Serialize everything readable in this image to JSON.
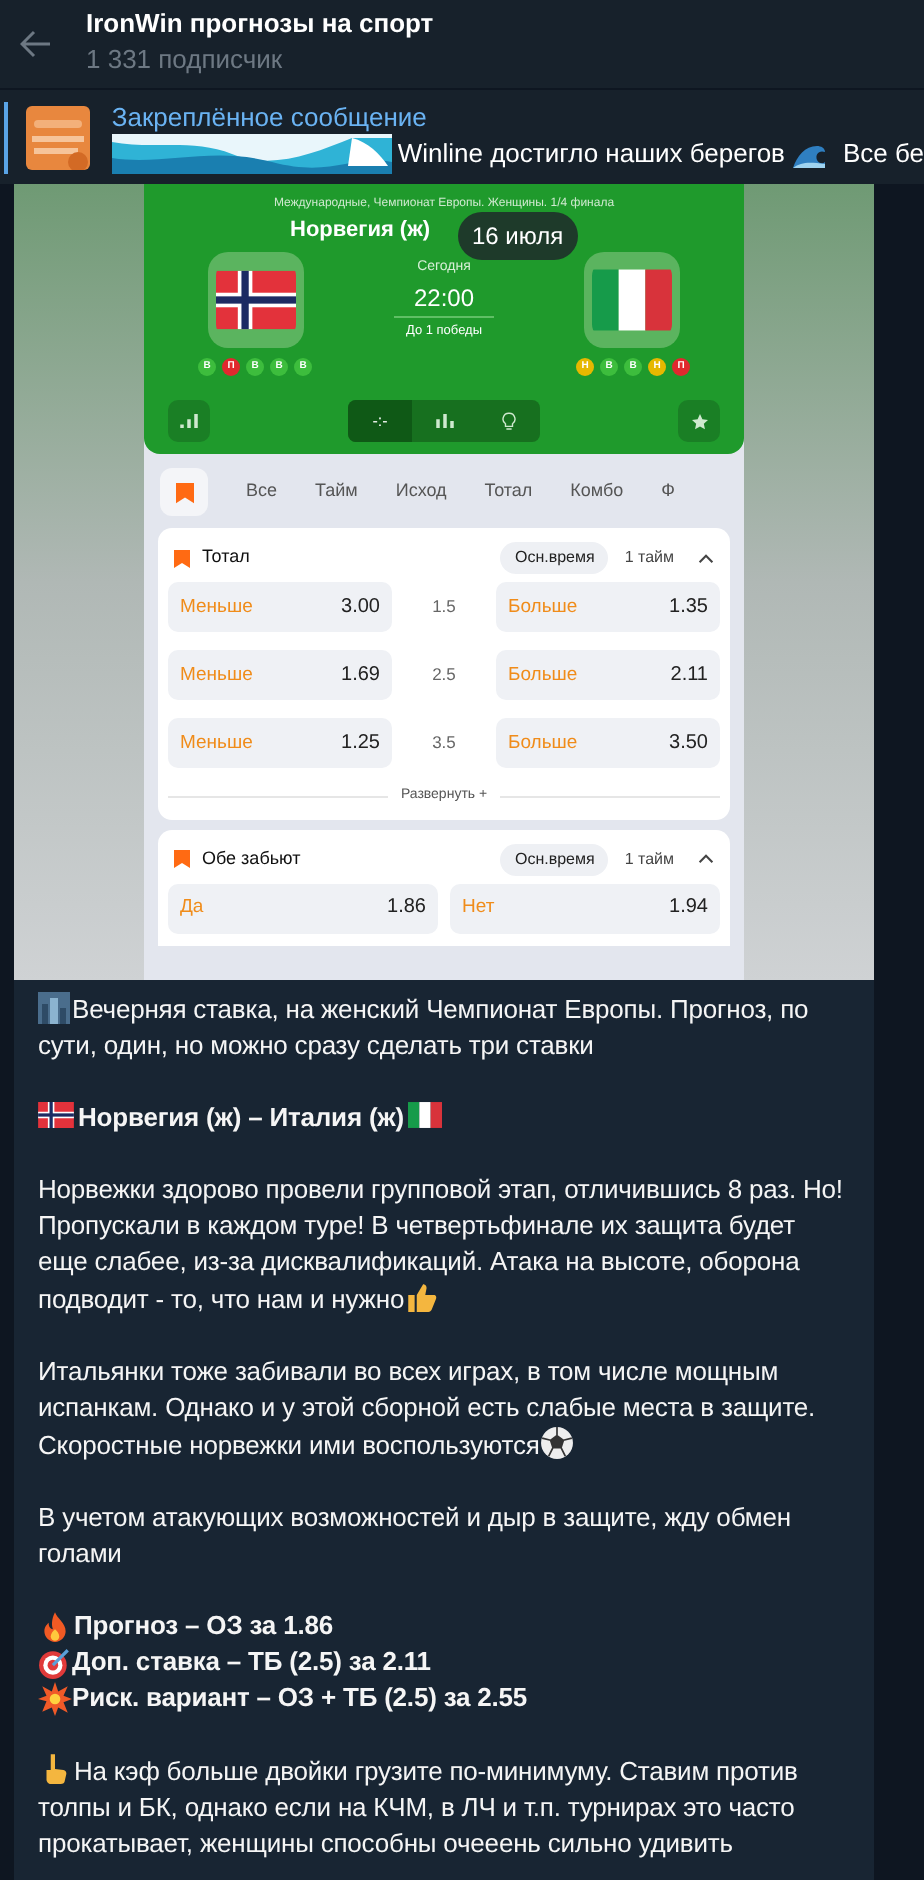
{
  "header": {
    "title": "IronWin прогнозы на спорт",
    "subtitle": "1 331 подписчик"
  },
  "pinned": {
    "title": "Закреплённое сообщение",
    "text": "Winline достигло наших берегов",
    "text_tail": "Все бе"
  },
  "date_pill": "16 июля",
  "app": {
    "competition": "Международные, Чемпионат Европы. Женщины. 1/4 финала",
    "match_title": "Норвегия (ж)",
    "day": "Сегодня",
    "time": "22:00",
    "format": "До 1 победы",
    "home_form": [
      {
        "letter": "В",
        "color": "#3dbd3d"
      },
      {
        "letter": "П",
        "color": "#e0282e"
      },
      {
        "letter": "В",
        "color": "#3dbd3d"
      },
      {
        "letter": "В",
        "color": "#3dbd3d"
      },
      {
        "letter": "В",
        "color": "#3dbd3d"
      }
    ],
    "away_form": [
      {
        "letter": "Н",
        "color": "#e6b800"
      },
      {
        "letter": "В",
        "color": "#3dbd3d"
      },
      {
        "letter": "В",
        "color": "#3dbd3d"
      },
      {
        "letter": "Н",
        "color": "#e6b800"
      },
      {
        "letter": "П",
        "color": "#e0282e"
      }
    ],
    "segments": [
      {
        "kind": "score",
        "label": "-:-",
        "selected": true
      },
      {
        "kind": "stats",
        "selected": false
      },
      {
        "kind": "tip",
        "selected": false
      }
    ],
    "tabs": [
      "Все",
      "Тайм",
      "Исход",
      "Тотал",
      "Комбо",
      "Ф"
    ],
    "total": {
      "title": "Тотал",
      "period": "Осн.время",
      "half": "1 тайм",
      "rows": [
        {
          "left": "Меньше",
          "left_odd": "3.00",
          "line": "1.5",
          "right": "Больше",
          "right_odd": "1.35"
        },
        {
          "left": "Меньше",
          "left_odd": "1.69",
          "line": "2.5",
          "right": "Больше",
          "right_odd": "2.11"
        },
        {
          "left": "Меньше",
          "left_odd": "1.25",
          "line": "3.5",
          "right": "Больше",
          "right_odd": "3.50"
        }
      ],
      "expand": "Развернуть +"
    },
    "btts": {
      "title": "Обе забьют",
      "period": "Осн.время",
      "half": "1 тайм",
      "yes": "Да",
      "yes_odd": "1.86",
      "no": "Нет",
      "no_odd": "1.94"
    }
  },
  "message": [
    {
      "text": "Вечерняя ставка, на женский Чемпионат Европы. Прогноз, по сути, один, но можно сразу сделать три ставки",
      "bold": false
    },
    {
      "text": "Норвегия (ж) – Италия (ж)",
      "bold": true
    },
    {
      "text": "Норвежки здорово провели групповой этап, отличившись 8 раз. Но! Пропускали в каждом туре! В четвертьфинале их защита будет еще слабее, из-за дисквалификаций. Атака на высоте, оборона подводит - то, что нам и нужно",
      "bold": false
    },
    {
      "text": "Итальянки тоже забивали во всех играх, в том числе мощным испанкам. Однако и у этой сборной есть слабые места в защите. Скоростные норвежки ими воспользуются",
      "bold": false
    },
    {
      "text": "В учетом атакующих возможностей и дыр в защите, жду обмен голами",
      "bold": false
    },
    {
      "items": [
        "Прогноз – ОЗ за 1.86",
        "Доп. ставка – ТБ (2.5) за 2.11",
        "Риск. вариант – ОЗ + ТБ (2.5) за 2.55"
      ],
      "bold": true
    },
    {
      "text": "На кэф больше двойки грузите по-минимуму. Ставим против толпы и БК, однако если на КЧМ, в ЛЧ и т.п. турнирах это часто прокатывает, женщины способны очееень сильно удивить",
      "bold": false
    }
  ]
}
